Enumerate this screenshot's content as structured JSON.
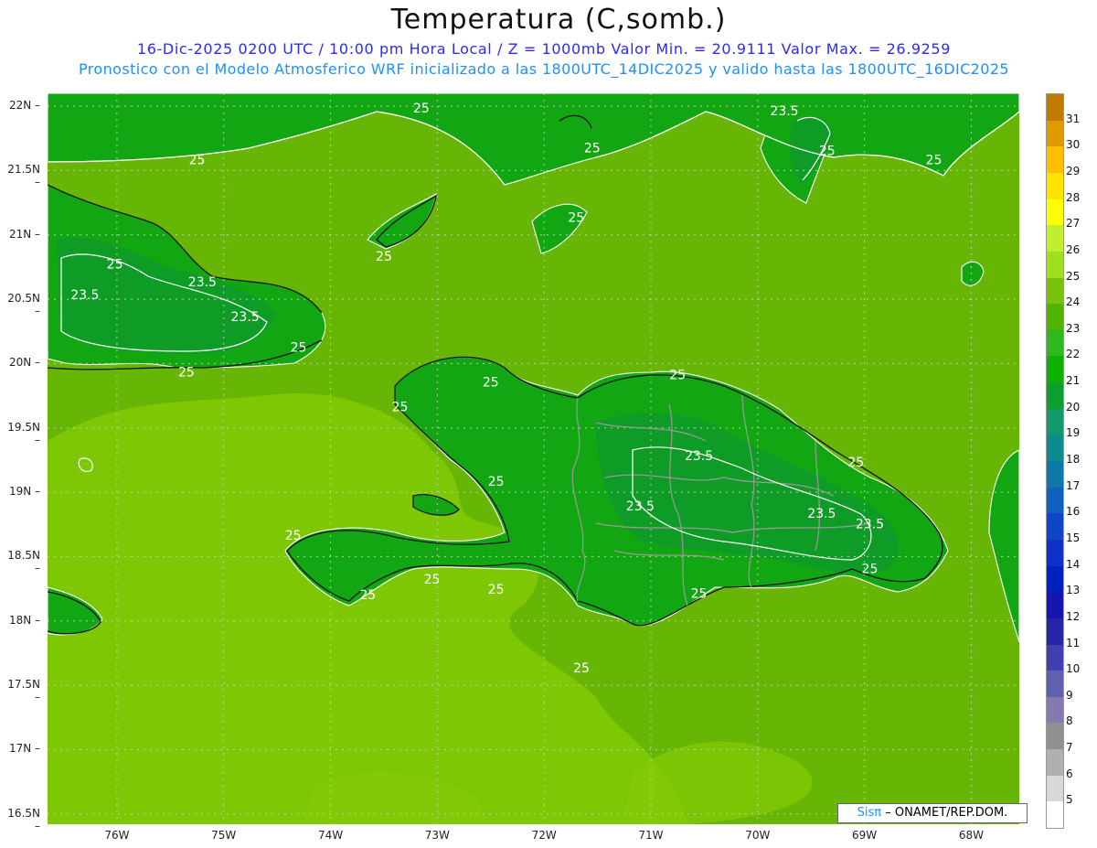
{
  "header": {
    "title": "Temperatura (C,somb.)",
    "line1": "16-Dic-2025 0200 UTC / 10:00 pm Hora Local / Z = 1000mb  Valor Min. = 20.9111  Valor Max. = 26.9259",
    "line2": "Pronostico con el Modelo Atmosferico WRF inicializado a las 1800UTC_14DIC2025 y valido hasta las  1800UTC_16DIC2025"
  },
  "axes": {
    "lat_labels": [
      "22N",
      "21.5N",
      "21N",
      "20.5N",
      "20N",
      "19.5N",
      "19N",
      "18.5N",
      "18N",
      "17.5N",
      "17N",
      "16.5N"
    ],
    "lon_labels": [
      "76W",
      "75W",
      "74W",
      "73W",
      "72W",
      "71W",
      "70W",
      "69W",
      "68W"
    ]
  },
  "colorbar": {
    "labels": [
      "31",
      "30",
      "29",
      "28",
      "27",
      "26",
      "25",
      "24",
      "23",
      "22",
      "21",
      "20",
      "19",
      "18",
      "17",
      "16",
      "15",
      "14",
      "13",
      "12",
      "11",
      "10",
      "9",
      "8",
      "7",
      "6",
      "5"
    ],
    "colors": [
      "#c07a00",
      "#e09a00",
      "#ffbe00",
      "#ffe300",
      "#ffff00",
      "#bfef2f",
      "#9ee01e",
      "#78c30a",
      "#50b400",
      "#2db81f",
      "#10b000",
      "#0d9f2f",
      "#15986c",
      "#0f8a8f",
      "#1077aa",
      "#1060c0",
      "#1045c8",
      "#1030c8",
      "#0020c0",
      "#1515b0",
      "#2525a8",
      "#4040b0",
      "#6060b0",
      "#8878b0",
      "#909090",
      "#b0b0b0",
      "#d8d8d8",
      "#ffffff"
    ]
  },
  "map": {
    "ocean_color": "#67b504",
    "ocean_light_color": "#85cc06",
    "land_color": "#13a613",
    "land_dark_color": "#0f9a2a",
    "contour_labels": [
      {
        "text": "25",
        "lon": -73.15,
        "lat": 21.95
      },
      {
        "text": "25",
        "lon": -71.55,
        "lat": 21.64
      },
      {
        "text": "25",
        "lon": -75.25,
        "lat": 21.55
      },
      {
        "text": "23.5",
        "lon": -69.75,
        "lat": 21.93
      },
      {
        "text": "25",
        "lon": -69.35,
        "lat": 21.62
      },
      {
        "text": "25",
        "lon": -68.35,
        "lat": 21.55
      },
      {
        "text": "25",
        "lon": -71.7,
        "lat": 21.1
      },
      {
        "text": "25",
        "lon": -73.5,
        "lat": 20.8
      },
      {
        "text": "25",
        "lon": -76.02,
        "lat": 20.74
      },
      {
        "text": "23.5",
        "lon": -76.3,
        "lat": 20.5
      },
      {
        "text": "23.5",
        "lon": -75.2,
        "lat": 20.6
      },
      {
        "text": "23.5",
        "lon": -74.8,
        "lat": 20.33
      },
      {
        "text": "25",
        "lon": -74.3,
        "lat": 20.09
      },
      {
        "text": "25",
        "lon": -75.35,
        "lat": 19.9
      },
      {
        "text": "25",
        "lon": -72.5,
        "lat": 19.82
      },
      {
        "text": "25",
        "lon": -70.75,
        "lat": 19.88
      },
      {
        "text": "25",
        "lon": -73.35,
        "lat": 19.63
      },
      {
        "text": "25",
        "lon": -72.45,
        "lat": 19.05
      },
      {
        "text": "23.5",
        "lon": -70.55,
        "lat": 19.25
      },
      {
        "text": "23.5",
        "lon": -71.1,
        "lat": 18.86
      },
      {
        "text": "23.5",
        "lon": -69.4,
        "lat": 18.8
      },
      {
        "text": "23.5",
        "lon": -68.95,
        "lat": 18.72
      },
      {
        "text": "25",
        "lon": -69.08,
        "lat": 19.2
      },
      {
        "text": "25",
        "lon": -74.35,
        "lat": 18.63
      },
      {
        "text": "25",
        "lon": -73.05,
        "lat": 18.29
      },
      {
        "text": "25",
        "lon": -72.45,
        "lat": 18.21
      },
      {
        "text": "25",
        "lon": -73.65,
        "lat": 18.17
      },
      {
        "text": "25",
        "lon": -70.55,
        "lat": 18.18
      },
      {
        "text": "25",
        "lon": -68.95,
        "lat": 18.37
      },
      {
        "text": "25",
        "lon": -71.65,
        "lat": 17.6
      }
    ]
  },
  "credit": {
    "brand": "Sisπ",
    "text": "– ONAMET/REP.DOM."
  }
}
